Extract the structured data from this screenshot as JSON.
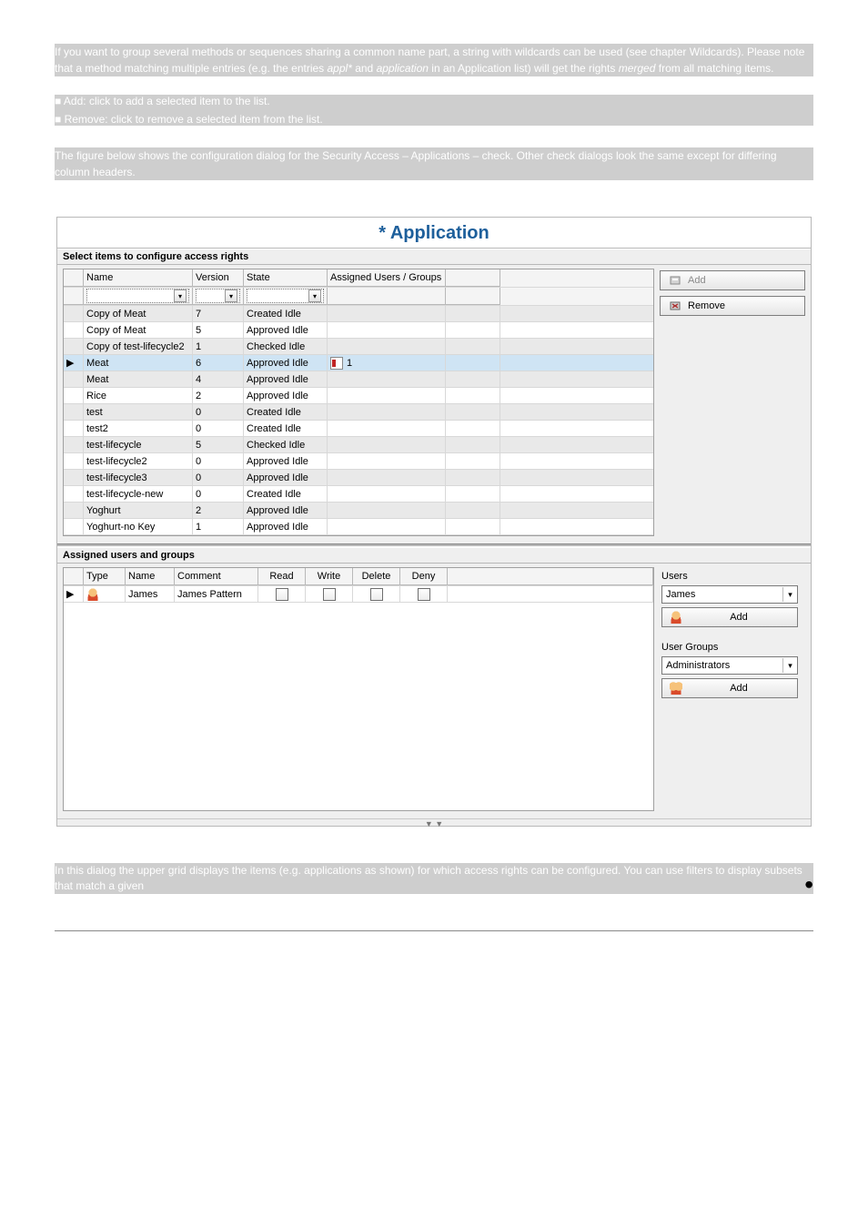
{
  "title": "* Application",
  "sections": {
    "top_label": "Select items to configure access rights",
    "bottom_label": "Assigned users and groups"
  },
  "columns": {
    "name": "Name",
    "version": "Version",
    "state": "State",
    "assigned": "Assigned Users / Groups"
  },
  "rows": [
    {
      "name": "Copy of Meat",
      "version": "7",
      "state": "Created Idle",
      "assigned": "",
      "alt": true
    },
    {
      "name": "Copy of Meat",
      "version": "5",
      "state": "Approved Idle",
      "assigned": "",
      "alt": false
    },
    {
      "name": "Copy of test-lifecycle2",
      "version": "1",
      "state": "Checked Idle",
      "assigned": "",
      "alt": true
    },
    {
      "name": "Meat",
      "version": "6",
      "state": "Approved Idle",
      "assigned": "1",
      "assigned_icon": true,
      "alt": false,
      "selected": true,
      "indicator": "▶"
    },
    {
      "name": "Meat",
      "version": "4",
      "state": "Approved Idle",
      "assigned": "",
      "alt": true
    },
    {
      "name": "Rice",
      "version": "2",
      "state": "Approved Idle",
      "assigned": "",
      "alt": false
    },
    {
      "name": "test",
      "version": "0",
      "state": "Created Idle",
      "assigned": "",
      "alt": true
    },
    {
      "name": "test2",
      "version": "0",
      "state": "Created Idle",
      "assigned": "",
      "alt": false
    },
    {
      "name": "test-lifecycle",
      "version": "5",
      "state": "Checked Idle",
      "assigned": "",
      "alt": true
    },
    {
      "name": "test-lifecycle2",
      "version": "0",
      "state": "Approved Idle",
      "assigned": "",
      "alt": false
    },
    {
      "name": "test-lifecycle3",
      "version": "0",
      "state": "Approved Idle",
      "assigned": "",
      "alt": true
    },
    {
      "name": "test-lifecycle-new",
      "version": "0",
      "state": "Created Idle",
      "assigned": "",
      "alt": false
    },
    {
      "name": "Yoghurt",
      "version": "2",
      "state": "Approved Idle",
      "assigned": "",
      "alt": true
    },
    {
      "name": "Yoghurt-no Key",
      "version": "1",
      "state": "Approved Idle",
      "assigned": "",
      "alt": false
    }
  ],
  "side_buttons": {
    "add": "Add",
    "remove": "Remove"
  },
  "lower_columns": {
    "type": "Type",
    "name": "Name",
    "comment": "Comment",
    "read": "Read",
    "write": "Write",
    "delete": "Delete",
    "deny": "Deny"
  },
  "lower_rows": [
    {
      "name": "James",
      "comment": "James Pattern",
      "indicator": "▶"
    }
  ],
  "right_panel": {
    "users_label": "Users",
    "users_value": "James",
    "add_user": "Add",
    "groups_label": "User Groups",
    "groups_value": "Administrators",
    "add_group": "Add"
  },
  "splitter": "▼ ▼"
}
